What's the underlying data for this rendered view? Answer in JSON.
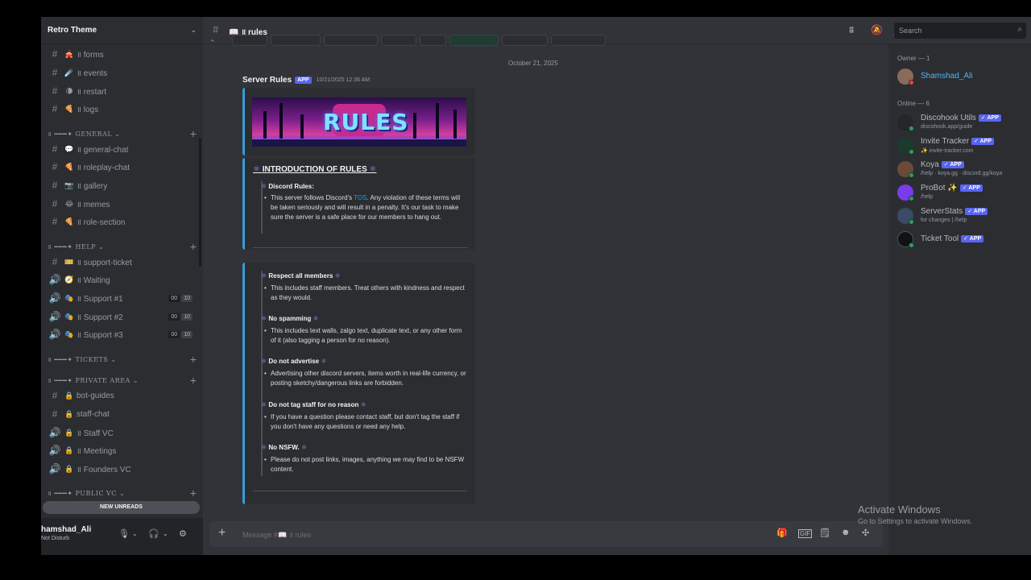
{
  "server": {
    "name": "Retro Theme"
  },
  "sidebar": {
    "channels_top": [
      {
        "emoji": "🎪",
        "label": "॥ forms"
      },
      {
        "emoji": "☄️",
        "label": "॥ events"
      },
      {
        "emoji": "🌘",
        "label": "॥ restart"
      },
      {
        "emoji": "🍕",
        "label": "॥ logs"
      }
    ],
    "categories": {
      "general": "॥ ━━━✦ GENERAL ⌄",
      "help": "॥ ━━━✦ HELP ⌄",
      "tickets": "॥ ━━━✦ TICKETS ⌄",
      "private": "॥ ━━━✦ PRIVATE AREA ⌄",
      "public_vc": "॥ ━━━✦ PUBLIC VC ⌄"
    },
    "general_channels": [
      {
        "emoji": "💬",
        "label": "॥ general-chat"
      },
      {
        "emoji": "🍕",
        "label": "॥ roleplay-chat"
      },
      {
        "emoji": "📷",
        "label": "॥ gallery"
      },
      {
        "emoji": "😂",
        "label": "॥ memes"
      },
      {
        "emoji": "🍕",
        "label": "॥ role-section"
      }
    ],
    "help_channels": [
      {
        "icon": "#",
        "emoji": "🎫",
        "label": "॥ support-ticket"
      },
      {
        "icon": "🔊",
        "emoji": "🧭",
        "label": "॥ Waiting"
      },
      {
        "icon": "🔊",
        "emoji": "🎭",
        "label": "॥ Support #1",
        "c1": "00",
        "c2": "10"
      },
      {
        "icon": "🔊",
        "emoji": "🎭",
        "label": "॥ Support #2",
        "c1": "00",
        "c2": "10"
      },
      {
        "icon": "🔊",
        "emoji": "🎭",
        "label": "॥ Support #3",
        "c1": "00",
        "c2": "10"
      }
    ],
    "private_channels": [
      {
        "icon": "#",
        "emoji": "🔒",
        "label": "bot-guides"
      },
      {
        "icon": "#",
        "emoji": "🔒",
        "label": "staff-chat"
      },
      {
        "icon": "🔊",
        "emoji": "🔒",
        "label": "॥ Staff VC"
      },
      {
        "icon": "🔊",
        "emoji": "🔒",
        "label": "॥ Meetings"
      },
      {
        "icon": "🔊",
        "emoji": "🔒",
        "label": "॥ Founders VC"
      }
    ],
    "new_unreads": "NEW UNREADS"
  },
  "user": {
    "name": "hamshad_Ali",
    "status": "Not Disturb"
  },
  "header": {
    "channel": "📖 ॥ rules",
    "search_placeholder": "Search"
  },
  "message": {
    "date": "October 21, 2025",
    "author": "Server Rules",
    "badge": "APP",
    "timestamp": "10/21/2025 12:36 AM",
    "banner_text": "RULES",
    "intro_title": "INTRODUCTION OF RULES",
    "intro_sub": "Discord Rules:",
    "intro_body_1": "This server follows Discord's ",
    "intro_tos": "TOS",
    "intro_body_2": ". Any violation of these terms will be taken seriously and will result in a penalty. It's our task to make sure the server is a safe place for our members to hang out.",
    "rules": [
      {
        "title": "Respect all members",
        "body": "This includes staff members. Treat others with kindness and respect as they would."
      },
      {
        "title": "No spamming",
        "body": "This includes text walls, zalgo text, duplicate text, or any other form of it (also tagging a person for no reason)."
      },
      {
        "title": "Do not advertise",
        "body": "Advertising other discord servers, items worth in real-life currency, or posting sketchy/dangerous links are forbidden."
      },
      {
        "title": "Do not tag staff for no reason",
        "body": "If you have a question please contact staff, but don't tag the staff if you don't have any questions or need any help."
      },
      {
        "title": "No NSFW.",
        "body": "Please do not post links, images, anything we may find to be NSFW content."
      }
    ]
  },
  "composer": {
    "placeholder": "Message #📖 ॥ rules"
  },
  "members": {
    "owner_header": "Owner — 1",
    "online_header": "Online — 6",
    "owner": {
      "name": "Shamshad_Ali"
    },
    "online": [
      {
        "name": "Discohook Utils",
        "tag": "✓ APP",
        "sub": "discohook.app/guide",
        "avatar": "#23272a"
      },
      {
        "name": "Invite Tracker",
        "tag": "✓ APP",
        "sub": "✨ invite-tracker.com",
        "avatar": "#1a3b2e"
      },
      {
        "name": "Koya",
        "tag": "✓ APP",
        "sub": "/help · koya.gg · discord.gg/koya",
        "avatar": "#6b4a3a"
      },
      {
        "name": "ProBot ✨",
        "tag": "✓ APP",
        "sub": "/help",
        "avatar": "#7c3aed"
      },
      {
        "name": "ServerStats",
        "tag": "✓ APP",
        "sub": "for changes | /help",
        "avatar": "#3b4a66"
      },
      {
        "name": "Ticket Tool",
        "tag": "✓ APP",
        "sub": "",
        "avatar": "#111214"
      }
    ]
  },
  "watermark": {
    "line1": "Activate Windows",
    "line2": "Go to Settings to activate Windows."
  },
  "colors": {
    "accent": "#5865f2",
    "online": "#23a55a",
    "dnd": "#f23f43",
    "embed_bar": "#3a9bd9",
    "link": "#00a8fc"
  }
}
